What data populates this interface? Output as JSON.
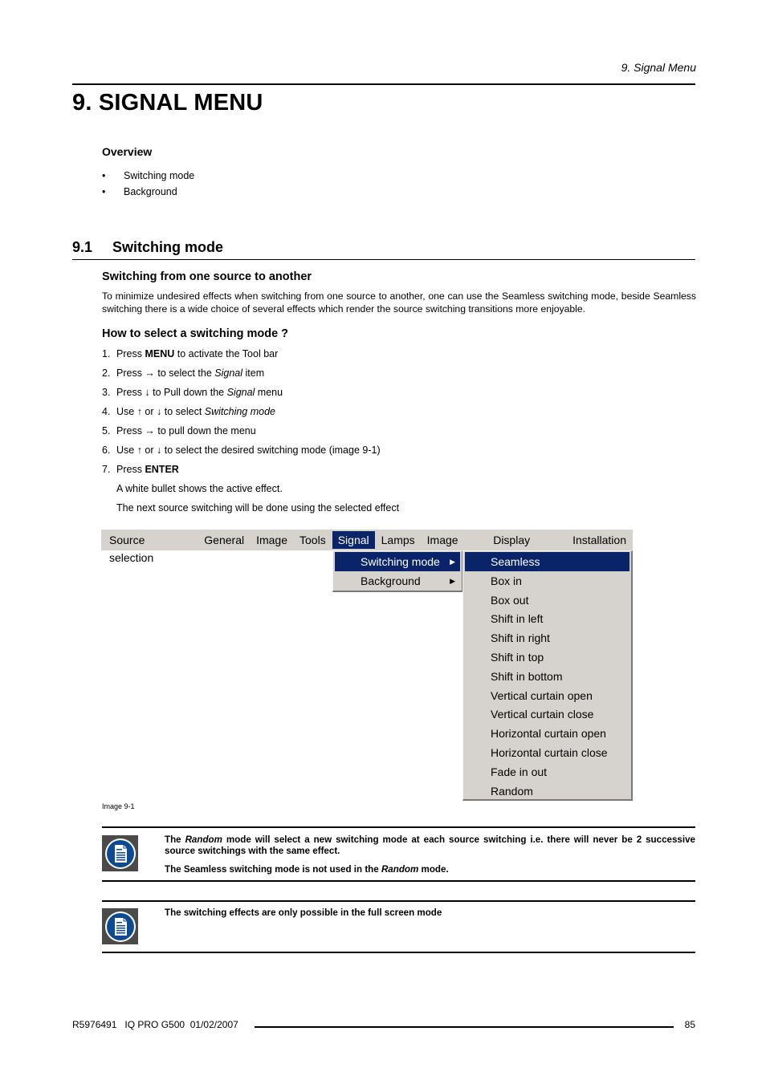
{
  "header": {
    "running_title": "9.  Signal Menu"
  },
  "chapter": {
    "title": "9.  SIGNAL MENU"
  },
  "overview": {
    "heading": "Overview",
    "bullet_glyph": "•",
    "items": [
      "Switching mode",
      "Background"
    ]
  },
  "section": {
    "number": "9.1",
    "title": "Switching mode",
    "sub1": {
      "heading": "Switching from one source to another",
      "paragraph": "To minimize undesired effects when switching from one source to another, one can use the Seamless switching mode, beside Seamless switching there is a wide choice of several effects which render the source switching transitions more enjoyable."
    },
    "sub2": {
      "heading": "How to select a switching mode ?",
      "steps": [
        {
          "num": "1.",
          "pre": "Press ",
          "em": "MENU",
          "em_style": "bold",
          "post": " to activate the Tool bar"
        },
        {
          "num": "2.",
          "pre": "Press → to select the ",
          "em": "Signal",
          "em_style": "italic",
          "post": " item"
        },
        {
          "num": "3.",
          "pre": "Press ↓ to Pull down the ",
          "em": "Signal",
          "em_style": "italic",
          "post": " menu"
        },
        {
          "num": "4.",
          "pre": "Use ↑ or ↓ to select ",
          "em": "Switching mode",
          "em_style": "italic",
          "post": ""
        },
        {
          "num": "5.",
          "pre": "Press → to pull down the menu",
          "em": "",
          "em_style": "",
          "post": ""
        },
        {
          "num": "6.",
          "pre": "Use ↑ or ↓ to select the desired switching mode (image 9-1)",
          "em": "",
          "em_style": "",
          "post": ""
        },
        {
          "num": "7.",
          "pre": "Press ",
          "em": "ENTER",
          "em_style": "bold",
          "post": ""
        }
      ],
      "notes": [
        "A white bullet shows the active effect.",
        "The next source switching will be done using the selected effect"
      ]
    }
  },
  "menu_screenshot": {
    "menubar": [
      "Source selection",
      "General",
      "Image",
      "Tools",
      "Signal",
      "Lamps",
      "Image files",
      "Display setup",
      "Installation"
    ],
    "active_menubar_item": "Signal",
    "signal_menu": [
      {
        "label": "Switching mode",
        "has_submenu": true,
        "highlighted": true
      },
      {
        "label": "Background",
        "has_submenu": true,
        "highlighted": false
      }
    ],
    "submenu_arrow_glyph": "▶",
    "switching_modes": [
      "Seamless",
      "Box in",
      "Box out",
      "Shift in left",
      "Shift in right",
      "Shift in top",
      "Shift in bottom",
      "Vertical curtain open",
      "Vertical curtain close",
      "Horizontal curtain open",
      "Horizontal curtain close",
      "Fade in out",
      "Random"
    ],
    "selected_mode": "Seamless",
    "colors": {
      "menu_bg": "#d6d3ce",
      "highlight_bg": "#0a246a",
      "highlight_fg": "#ffffff"
    },
    "caption": "Image 9-1"
  },
  "notes": [
    {
      "icon": "note-document-icon",
      "paragraphs": [
        [
          {
            "t": "The "
          },
          {
            "t": "Random",
            "i": true
          },
          {
            "t": " mode will select a new switching mode at each source switching i.e.  there will never be 2 successive source switchings with the same effect."
          }
        ],
        [
          {
            "t": "The Seamless switching mode is not used in the "
          },
          {
            "t": "Random",
            "i": true
          },
          {
            "t": " mode."
          }
        ]
      ]
    },
    {
      "icon": "note-document-icon",
      "paragraphs": [
        [
          {
            "t": "The switching effects are only possible in the full screen mode"
          }
        ]
      ]
    }
  ],
  "footer": {
    "left": "R5976491   IQ PRO G500  01/02/2007",
    "page": "85"
  },
  "colors": {
    "note_icon_bg": "#4a4a4a",
    "note_icon_circle": "#0d4a94"
  }
}
